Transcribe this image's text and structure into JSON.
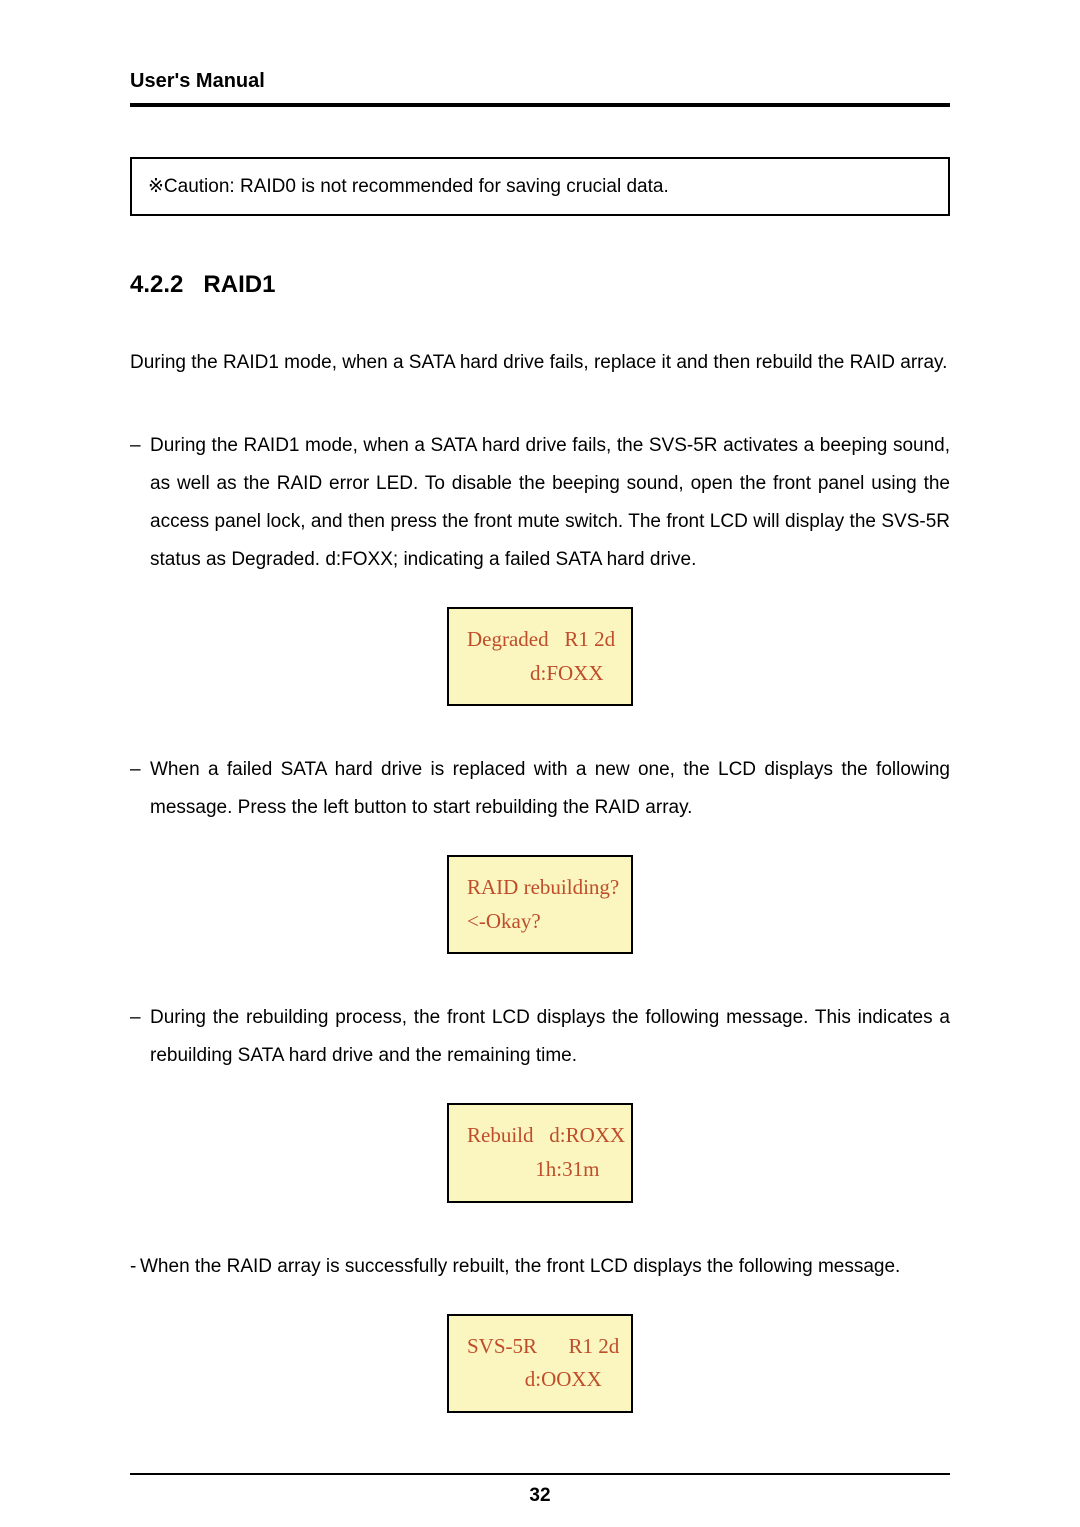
{
  "header": {
    "title": "User's Manual"
  },
  "caution": {
    "symbol": "※",
    "text": "Caution: RAID0 is not recommended for saving crucial data."
  },
  "section": {
    "number": "4.2.2",
    "title": "RAID1"
  },
  "intro": "During the RAID1 mode, when a SATA hard drive fails, replace it and then rebuild the RAID array.",
  "items": [
    {
      "dash": "–",
      "text": "During the RAID1 mode, when a SATA hard drive fails, the SVS-5R activates a beeping sound, as well as the RAID error LED. To disable the beeping sound, open the front panel using the access panel lock, and then press the front mute switch. The front LCD will display the SVS-5R status as Degraded. d:FOXX; indicating a failed SATA hard drive.",
      "lcd": "Degraded   R1 2d\n            d:FOXX"
    },
    {
      "dash": "–",
      "text": "When a failed SATA hard drive is replaced with a new one, the LCD displays the following message. Press the left button to start rebuilding the RAID array.",
      "lcd": "RAID rebuilding?\n<-Okay?"
    },
    {
      "dash": "–",
      "text": "During the rebuilding process, the front LCD displays the following message. This indicates a rebuilding SATA hard drive and the remaining time.",
      "lcd": "Rebuild   d:ROXX\n             1h:31m"
    },
    {
      "dash": "-",
      "text": " When the RAID array is successfully rebuilt, the front LCD displays the following message.",
      "lcd": "SVS-5R      R1 2d\n           d:OOXX"
    }
  ],
  "footer": {
    "page_number": "32"
  }
}
